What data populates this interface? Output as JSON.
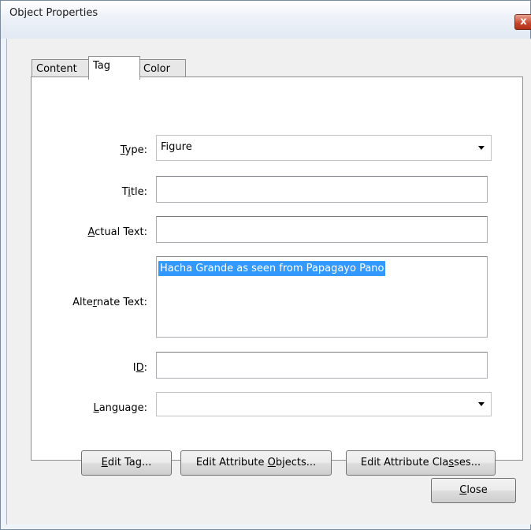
{
  "window": {
    "title": "Object Properties",
    "close_glyph": "x"
  },
  "tabs": [
    {
      "label": "Content",
      "active": false
    },
    {
      "label": "Tag",
      "active": true
    },
    {
      "label": "Color",
      "active": false
    }
  ],
  "form": {
    "type": {
      "label_pre": "",
      "label_key": "T",
      "label_post": "ype:",
      "value": "Figure"
    },
    "title": {
      "label_pre": "T",
      "label_key": "i",
      "label_post": "tle:",
      "value": ""
    },
    "actual_text": {
      "label_pre": "",
      "label_key": "A",
      "label_post": "ctual Text:",
      "value": ""
    },
    "alternate_text": {
      "label_pre": "Alte",
      "label_key": "r",
      "label_post": "nate Text:",
      "value": "Hacha Grande as seen from Papagayo Pano"
    },
    "id": {
      "label_pre": "I",
      "label_key": "D",
      "label_post": ":",
      "value": ""
    },
    "language": {
      "label_pre": "",
      "label_key": "L",
      "label_post": "anguage:",
      "value": ""
    }
  },
  "buttons": {
    "edit_tag": {
      "pre": "",
      "key": "E",
      "post": "dit Tag..."
    },
    "edit_attr_objects": {
      "pre": "Edit Attribute ",
      "key": "O",
      "post": "bjects..."
    },
    "edit_attr_classes": {
      "pre": "Edit Attribute Cla",
      "key": "s",
      "post": "ses..."
    },
    "close": {
      "pre": "",
      "key": "C",
      "post": "lose"
    }
  }
}
